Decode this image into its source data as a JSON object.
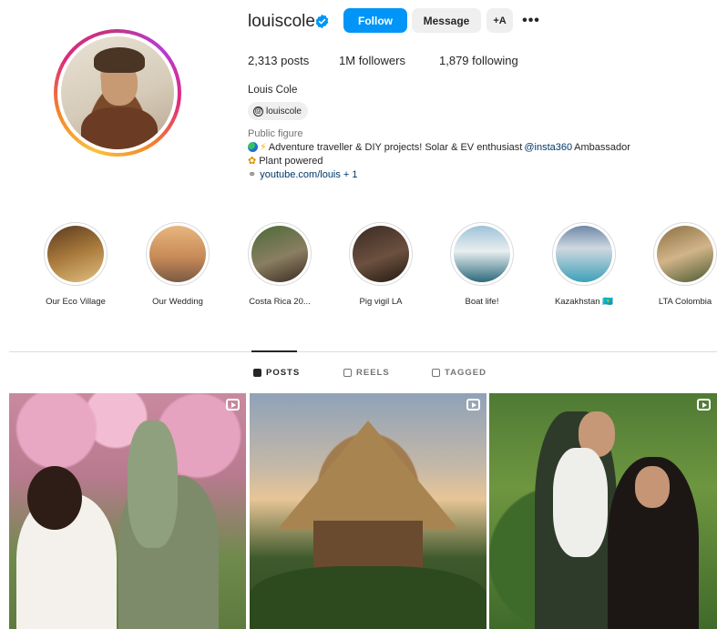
{
  "profile": {
    "username": "louiscole",
    "follow_label": "Follow",
    "message_label": "Message",
    "add_user_label": "+A",
    "more_label": "•••",
    "stats": {
      "posts_count": "2,313",
      "posts_label": "posts",
      "followers_count": "1M",
      "followers_label": "followers",
      "following_count": "1,879",
      "following_label": "following"
    },
    "full_name": "Louis Cole",
    "threads_handle": "louiscole",
    "category": "Public figure",
    "bio_line1_text": "Adventure traveller & DIY projects! Solar & EV enthusiast ",
    "bio_line1_mention": "@insta360",
    "bio_line1_suffix": " Ambassador",
    "bio_line2_text": "Plant powered",
    "link_text": "youtube.com/louis + 1"
  },
  "highlights": [
    {
      "label": "Our Eco Village",
      "bg": "linear-gradient(160deg,#5a3a1f,#a97a3c 50%,#e0c080)"
    },
    {
      "label": "Our Wedding",
      "bg": "linear-gradient(180deg,#e7b77f,#c98a58 55%,#7a5a44)"
    },
    {
      "label": "Costa Rica 20...",
      "bg": "linear-gradient(160deg,#4c6a38,#8a7e62 55%,#3a2a20)"
    },
    {
      "label": "Pig vigil LA",
      "bg": "linear-gradient(160deg,#3a2a22,#6c5040 55%,#22180f)"
    },
    {
      "label": "Boat life!",
      "bg": "linear-gradient(180deg,#9fc2d8,#e9eef0 45%,#2c6a7c)"
    },
    {
      "label": "Kazakhstan 🇰🇿",
      "bg": "linear-gradient(180deg,#6e88a8,#cfd8e0 40%,#3ea0b8)"
    },
    {
      "label": "LTA Colombia",
      "bg": "linear-gradient(160deg,#8a7040,#d2b48a 50%,#4a5a30)"
    }
  ],
  "tabs": {
    "posts": "POSTS",
    "reels": "REELS",
    "tagged": "TAGGED"
  },
  "colors": {
    "accent": "#0095f6",
    "link": "#00376b",
    "muted": "#737373"
  }
}
